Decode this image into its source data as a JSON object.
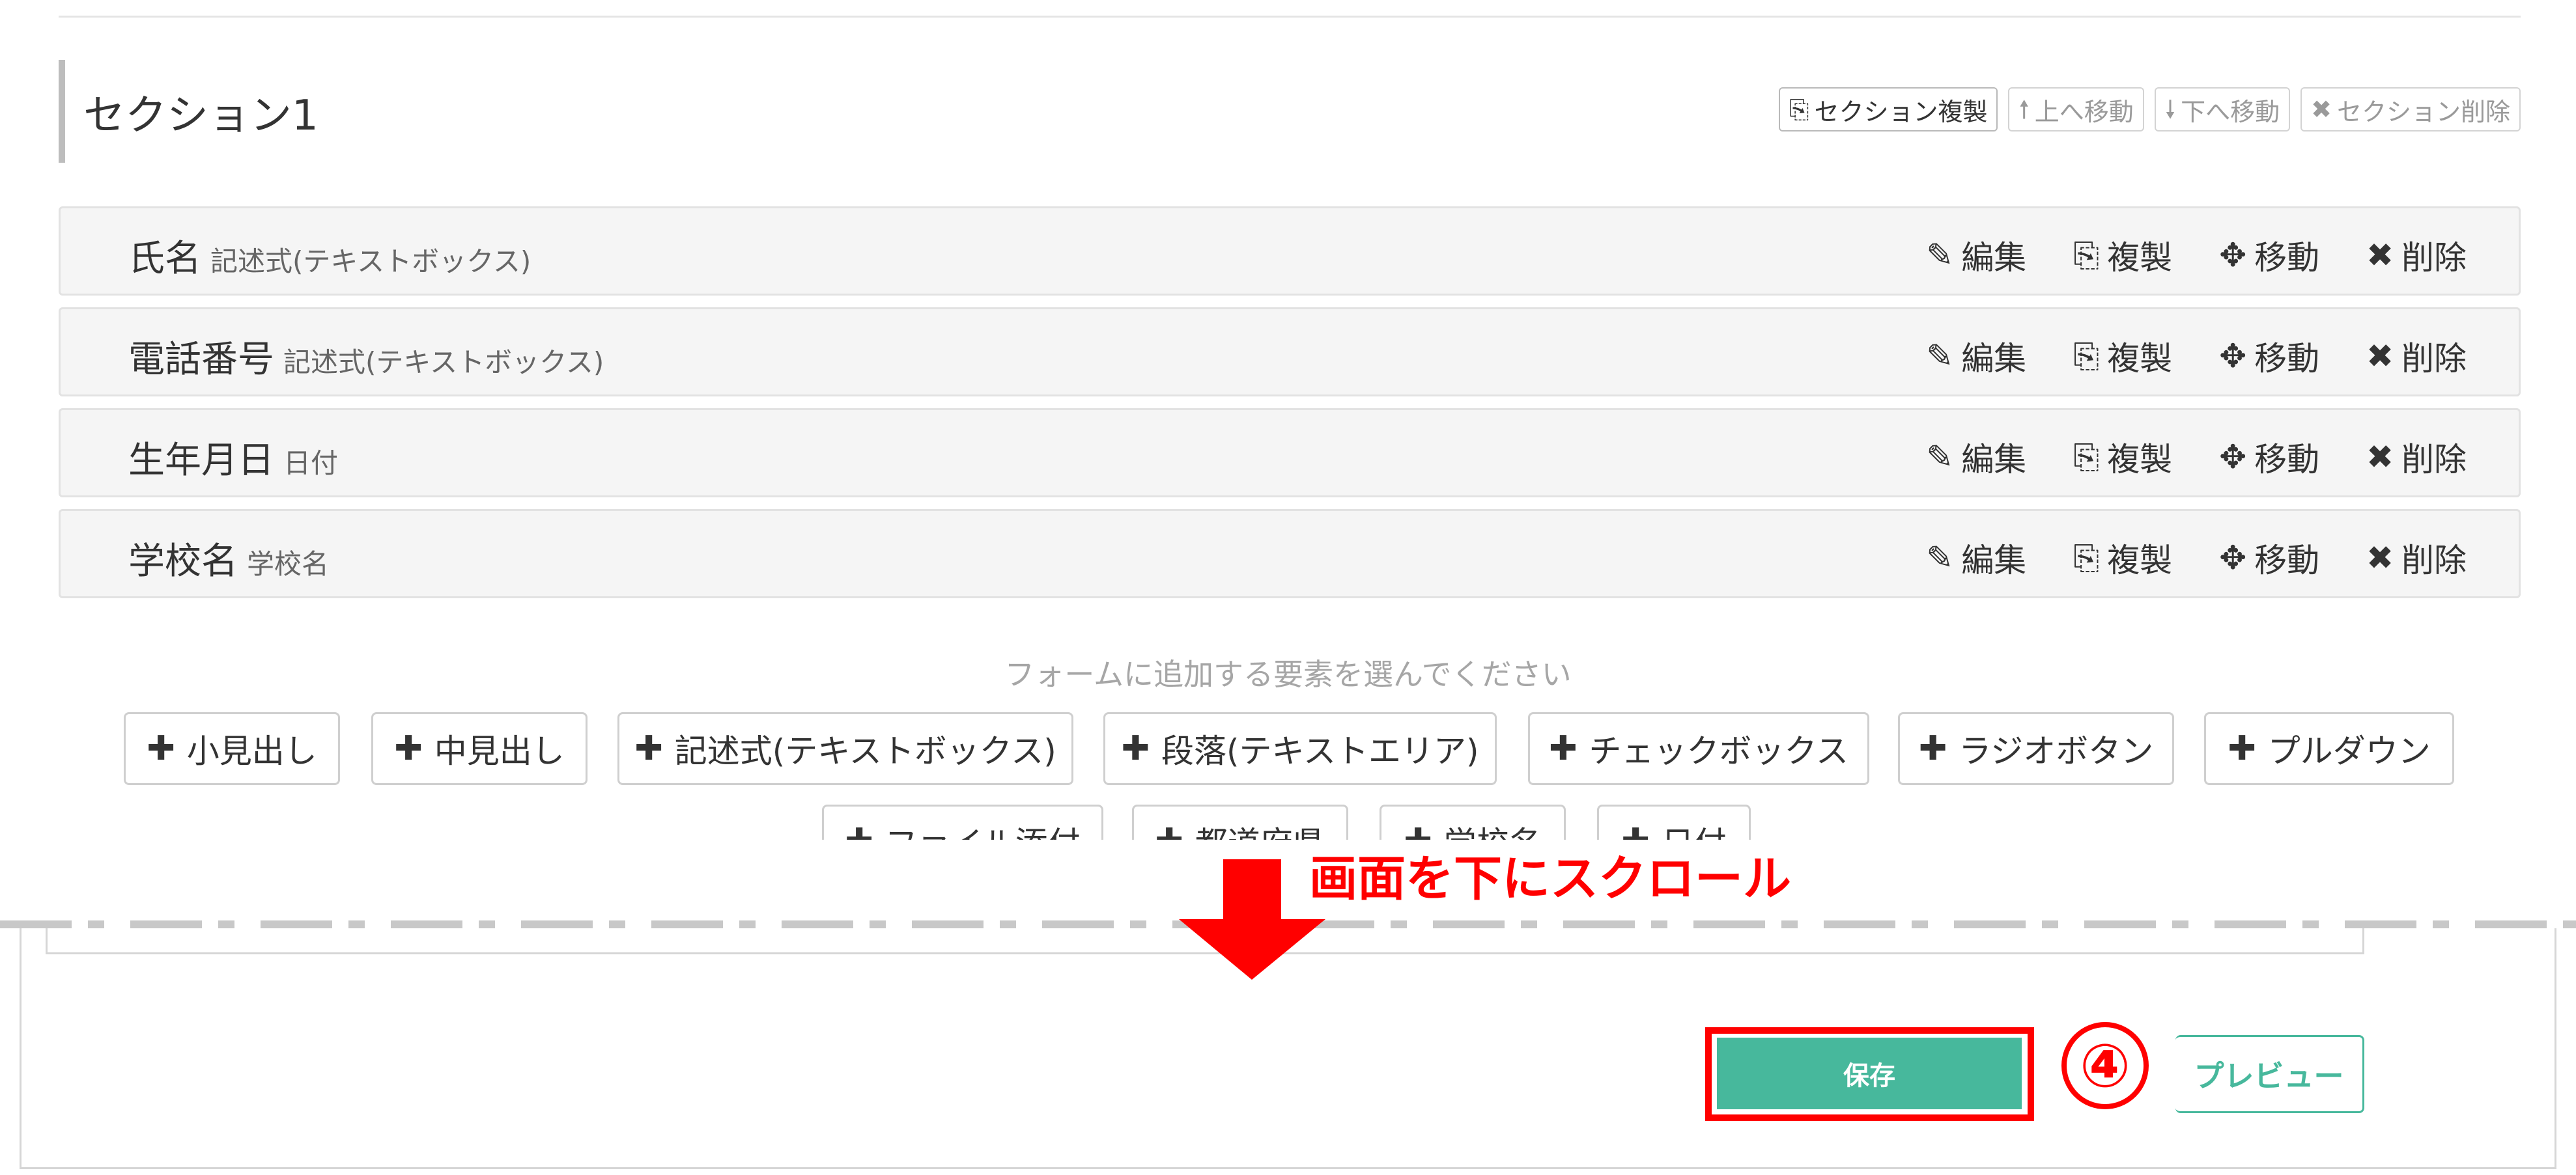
{
  "section": {
    "title": "セクション1",
    "actions": [
      {
        "icon": "duplicate-icon",
        "glyph": "⎘",
        "label": "セクション複製"
      },
      {
        "icon": "arrow-up-icon",
        "glyph": "🠕",
        "label": "上へ移動"
      },
      {
        "icon": "arrow-down-icon",
        "glyph": "🠗",
        "label": "下へ移動"
      },
      {
        "icon": "close-icon",
        "glyph": "✖",
        "label": "セクション削除"
      }
    ]
  },
  "row_actions": {
    "edit": "編集",
    "duplicate": "複製",
    "move": "移動",
    "delete": "削除"
  },
  "fields": [
    {
      "label": "氏名",
      "type": "記述式(テキストボックス)"
    },
    {
      "label": "電話番号",
      "type": "記述式(テキストボックス)"
    },
    {
      "label": "生年月日",
      "type": "日付"
    },
    {
      "label": "学校名",
      "type": "学校名"
    }
  ],
  "add_area": {
    "prompt": "フォームに追加する要素を選んでください",
    "buttons": [
      "小見出し",
      "中見出し",
      "記述式(テキストボックス)",
      "段落(テキストエリア)",
      "チェックボックス",
      "ラジオボタン",
      "プルダウン",
      "ファイル添付",
      "都道府県",
      "学校名",
      "日付"
    ]
  },
  "annotation": {
    "scroll_note": "画面を下にスクロール",
    "step_number": "④",
    "accent_color": "#ff0000"
  },
  "footer": {
    "save_label": "保存",
    "preview_label": "プレビュー",
    "primary_color": "#47b89c"
  }
}
